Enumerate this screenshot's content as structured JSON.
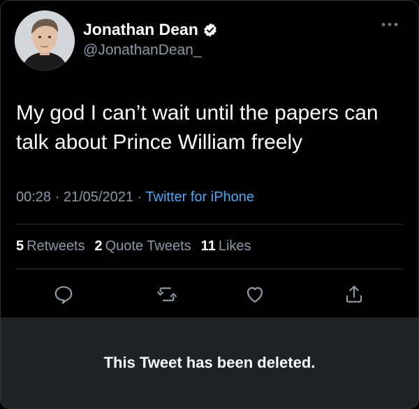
{
  "user": {
    "display_name": "Jonathan Dean",
    "handle": "@JonathanDean_",
    "verified": true
  },
  "tweet": {
    "text": "My god I can’t wait until the papers can talk about Prince William freely",
    "time": "00:28",
    "date": "21/05/2021",
    "separator": "·",
    "source": "Twitter for iPhone"
  },
  "stats": [
    {
      "count": "5",
      "label": "Retweets"
    },
    {
      "count": "2",
      "label": "Quote Tweets"
    },
    {
      "count": "11",
      "label": "Likes"
    }
  ],
  "actions": [
    {
      "icon": "reply-icon"
    },
    {
      "icon": "retweet-icon"
    },
    {
      "icon": "like-icon"
    },
    {
      "icon": "share-icon"
    }
  ],
  "notice": {
    "text": "This Tweet has been deleted."
  },
  "colors": {
    "background": "#000000",
    "text": "#ffffff",
    "muted": "#8b98a5",
    "link": "#4aa8f5",
    "panel": "#1e2328",
    "divider": "#2f3336"
  }
}
